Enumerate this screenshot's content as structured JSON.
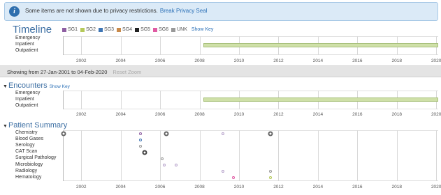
{
  "banner": {
    "message": "Some items are not shown due to privacy restrictions.",
    "link": "Break Privacy Seal",
    "icon": "info-icon"
  },
  "timeline": {
    "title": "Timeline",
    "legend": [
      {
        "label": "SG1",
        "color": "#8e5ea2"
      },
      {
        "label": "SG2",
        "color": "#b5c95a"
      },
      {
        "label": "SG3",
        "color": "#3f76b5"
      },
      {
        "label": "SG4",
        "color": "#c98a4a"
      },
      {
        "label": "SG5",
        "color": "#222222"
      },
      {
        "label": "SG6",
        "color": "#e05ba3"
      },
      {
        "label": "UNK",
        "color": "#999999"
      }
    ],
    "show_key": "Show Key",
    "rows": [
      "Emergency",
      "Inpatient",
      "Outpatient"
    ],
    "axis_years": [
      "2002",
      "2004",
      "2006",
      "2008",
      "2010",
      "2012",
      "2014",
      "2016",
      "2018",
      "2020"
    ],
    "inpatient_bar": {
      "start_year": 2008.2,
      "end_year": 2020.1,
      "color": "#cfe0a8"
    }
  },
  "range": {
    "text": "Showing from 27-Jan-2001 to 04-Feb-2020",
    "reset": "Reset Zoom"
  },
  "encounters": {
    "title": "Encounters",
    "show_key": "Show Key",
    "rows": [
      "Emergency",
      "Inpatient",
      "Outpatient"
    ],
    "axis_years": [
      "2002",
      "2004",
      "2006",
      "2008",
      "2010",
      "2012",
      "2014",
      "2016",
      "2018",
      "2020"
    ],
    "inpatient_bar": {
      "start_year": 2008.2,
      "end_year": 2020.1
    }
  },
  "summary": {
    "title": "Patient Summary",
    "rows": [
      "Chemistry",
      "Blood Gases",
      "Serology",
      "CAT Scan",
      "Surgical Pathology",
      "Microbiology",
      "Radiology",
      "Hematology"
    ],
    "axis_years": [
      "2002",
      "2004",
      "2006",
      "2008",
      "2010",
      "2012",
      "2014",
      "2016",
      "2018",
      "2020"
    ],
    "events": [
      {
        "row": 0,
        "year": 2001.1,
        "size": "large",
        "color": "#666666"
      },
      {
        "row": 0,
        "year": 2005.0,
        "size": "small",
        "color": "#8e5ea2"
      },
      {
        "row": 0,
        "year": 2006.3,
        "size": "large",
        "color": "#666666"
      },
      {
        "row": 0,
        "year": 2009.2,
        "size": "small",
        "color": "#b5a0c9"
      },
      {
        "row": 0,
        "year": 2011.6,
        "size": "large",
        "color": "#666666"
      },
      {
        "row": 1,
        "year": 2005.0,
        "size": "small",
        "color": "#3f76b5"
      },
      {
        "row": 2,
        "year": 2005.0,
        "size": "small",
        "color": "#999999"
      },
      {
        "row": 3,
        "year": 2005.2,
        "size": "large",
        "color": "#444444"
      },
      {
        "row": 4,
        "year": 2006.1,
        "size": "small",
        "color": "#999999"
      },
      {
        "row": 5,
        "year": 2006.2,
        "size": "small",
        "color": "#b5a0c9"
      },
      {
        "row": 5,
        "year": 2006.8,
        "size": "small",
        "color": "#b5a0c9"
      },
      {
        "row": 6,
        "year": 2009.2,
        "size": "small",
        "color": "#b5a0c9"
      },
      {
        "row": 6,
        "year": 2011.6,
        "size": "small",
        "color": "#999999"
      },
      {
        "row": 7,
        "year": 2009.7,
        "size": "small",
        "color": "#e05ba3"
      },
      {
        "row": 7,
        "year": 2011.6,
        "size": "small",
        "color": "#b5c95a"
      }
    ]
  }
}
